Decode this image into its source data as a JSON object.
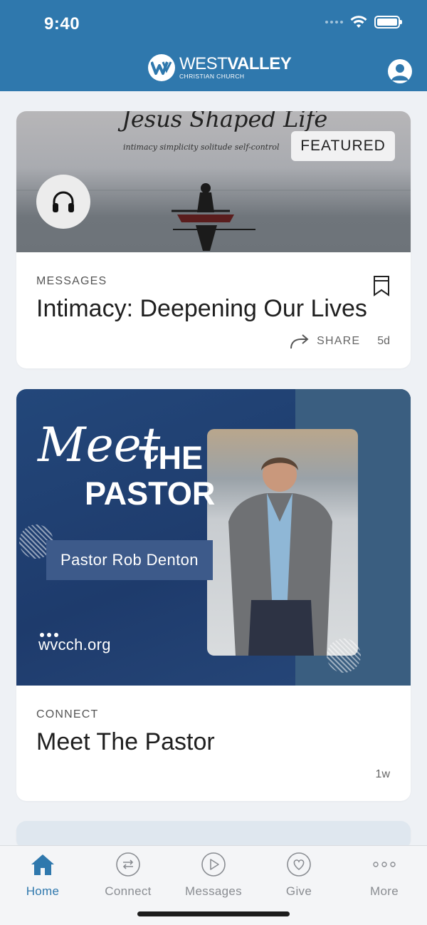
{
  "status_bar": {
    "time": "9:40"
  },
  "header": {
    "logo_main_light": "WEST",
    "logo_main_bold": "VALLEY",
    "logo_sub": "CHRISTIAN CHURCH",
    "profile_icon": "user-circle-icon"
  },
  "feed": [
    {
      "category": "MESSAGES",
      "title": "Intimacy: Deepening Our Lives",
      "badge": "FEATURED",
      "image_script_text": "Jesus Shaped Life",
      "image_words": "intimacy  simplicity  solitude  self-control",
      "media_icon": "headphones-icon",
      "share_label": "SHARE",
      "age": "5d"
    },
    {
      "category": "CONNECT",
      "title": "Meet The Pastor",
      "image_script": "Meet",
      "image_bold_1": "THE",
      "image_bold_2": "PASTOR",
      "image_name": "Pastor Rob Denton",
      "image_url": "wvcch.org",
      "age": "1w"
    }
  ],
  "tabs": [
    {
      "label": "Home",
      "icon": "home-icon",
      "active": true
    },
    {
      "label": "Connect",
      "icon": "connect-icon",
      "active": false
    },
    {
      "label": "Messages",
      "icon": "play-icon",
      "active": false
    },
    {
      "label": "Give",
      "icon": "heart-icon",
      "active": false
    },
    {
      "label": "More",
      "icon": "more-icon",
      "active": false
    }
  ],
  "colors": {
    "brand": "#2f78ad",
    "tab_inactive": "#8a8d92",
    "background": "#eef1f5"
  }
}
